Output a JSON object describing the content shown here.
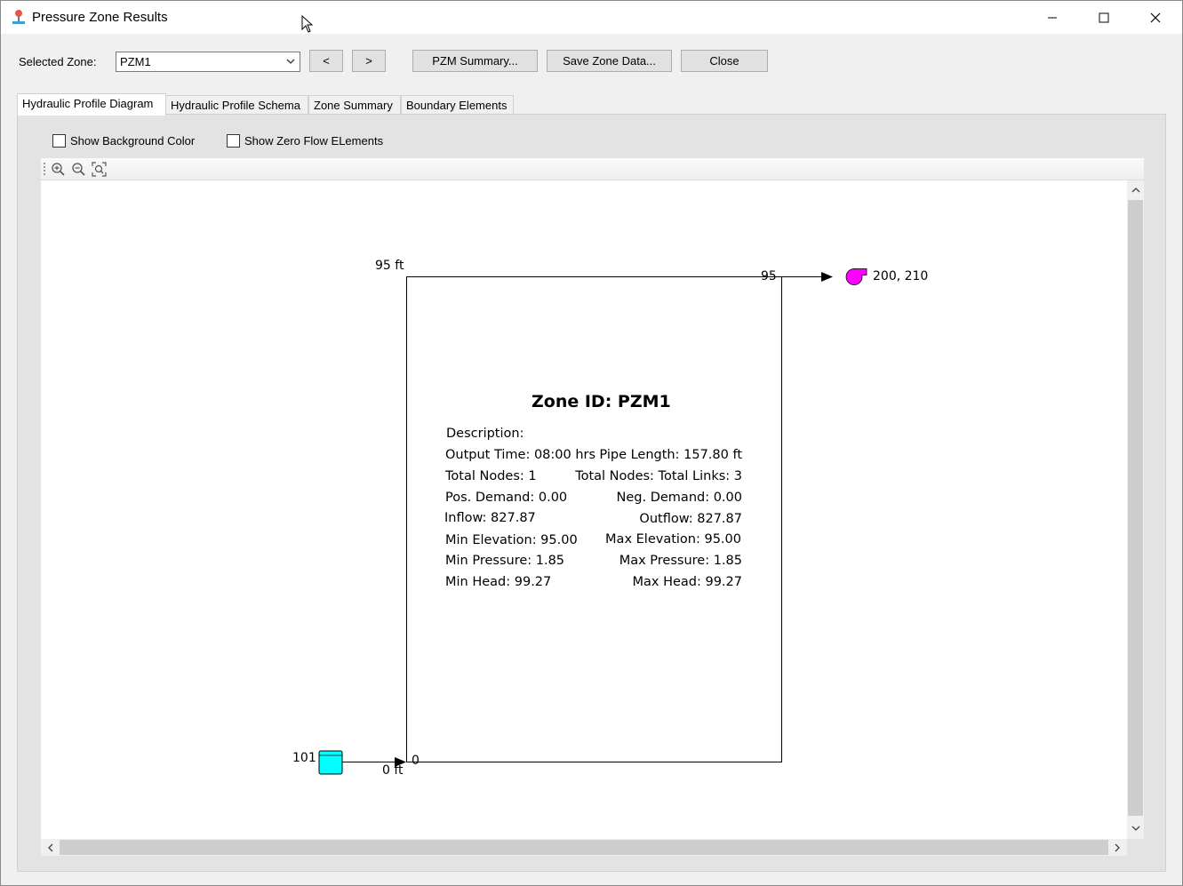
{
  "window": {
    "title": "Pressure Zone Results",
    "minimize_label": "—",
    "maximize_label": "☐",
    "close_label": "✕"
  },
  "toolbar": {
    "selected_zone_label": "Selected Zone:",
    "selected_zone_value": "PZM1",
    "prev_label": "<",
    "next_label": ">",
    "pzm_summary_label": "PZM Summary...",
    "save_zone_data_label": "Save Zone Data...",
    "close_label": "Close"
  },
  "tabs": [
    {
      "label": "Hydraulic Profile Diagram",
      "active": true
    },
    {
      "label": "Hydraulic Profile Schema",
      "active": false
    },
    {
      "label": "Zone Summary",
      "active": false
    },
    {
      "label": "Boundary Elements",
      "active": false
    }
  ],
  "options": {
    "show_background_color": {
      "label": "Show Background Color",
      "checked": false
    },
    "show_zero_flow": {
      "label": "Show Zero Flow ELements",
      "checked": false
    }
  },
  "diagram_tools": [
    "zoom-in-icon",
    "zoom-out-icon",
    "zoom-fit-icon"
  ],
  "diagram": {
    "top_elevation_label": "95 ft",
    "top_right_value": "95",
    "pump_label": "200, 210",
    "tank_label": "101",
    "bottom_elevation_label": "0 ft",
    "bottom_left_value": "0",
    "pump_color": "#ff00ff",
    "tank_color": "#00ffff",
    "info": {
      "title": "Zone ID: PZM1",
      "description": "Description:",
      "output_time": "Output Time: 08:00 hrs",
      "pipe_length": "Pipe Length: 157.80 ft",
      "total_nodes": "Total Nodes: 1",
      "total_links": "Total Nodes: Total Links: 3",
      "pos_demand": "Pos. Demand: 0.00",
      "neg_demand": "Neg. Demand: 0.00",
      "inflow": "Inflow: 827.87",
      "outflow": "Outflow: 827.87",
      "min_elevation": "Min Elevation: 95.00",
      "max_elevation": "Max Elevation: 95.00",
      "min_pressure": "Min Pressure: 1.85",
      "max_pressure": "Max Pressure: 1.85",
      "min_head": "Min Head: 99.27",
      "max_head": "Max Head: 99.27"
    }
  }
}
